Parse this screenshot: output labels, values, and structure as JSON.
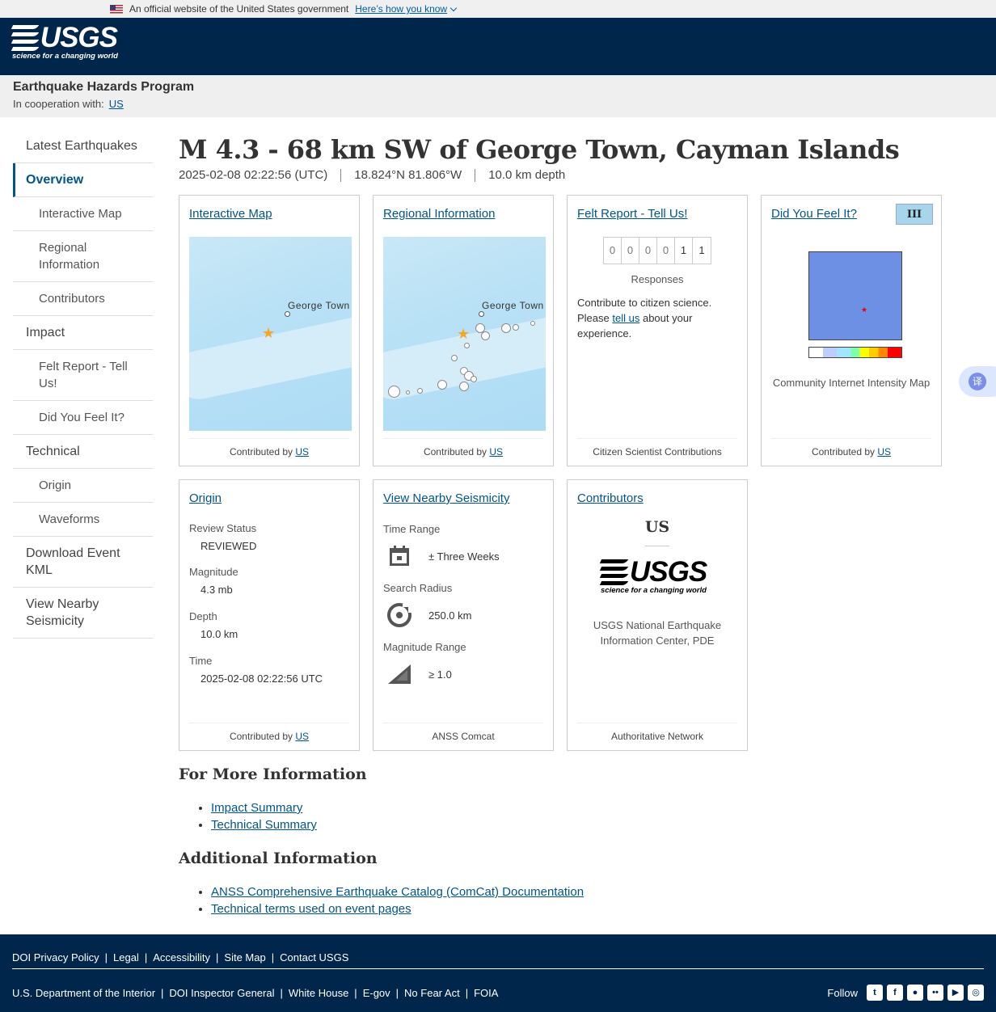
{
  "gov_banner": {
    "text": "An official website of the United States government",
    "link": "Here’s how you know"
  },
  "logo": {
    "word": "USGS",
    "tagline": "science for a changing world"
  },
  "program": {
    "title": "Earthquake Hazards Program",
    "coop_label": "In cooperation with:",
    "coop_link": "US"
  },
  "nav": [
    {
      "label": "Latest Earthquakes"
    },
    {
      "label": "Overview"
    },
    {
      "label": "Interactive Map"
    },
    {
      "label": "Regional Information"
    },
    {
      "label": "Contributors"
    },
    {
      "label": "Impact"
    },
    {
      "label": "Felt Report - Tell Us!"
    },
    {
      "label": "Did You Feel It?"
    },
    {
      "label": "Technical"
    },
    {
      "label": "Origin"
    },
    {
      "label": "Waveforms"
    },
    {
      "label": "Download Event KML"
    },
    {
      "label": "View Nearby Seismicity"
    }
  ],
  "event": {
    "title": "M 4.3 - 68 km SW of George Town, Cayman Islands",
    "time": "2025-02-08 02:22:56 (UTC)",
    "location": "18.824°N 81.806°W",
    "depth": "10.0 km depth"
  },
  "cards": {
    "interactive_map": {
      "title": "Interactive Map",
      "map_label": "George Town",
      "foot_text": "Contributed by",
      "foot_link": "US"
    },
    "regional": {
      "title": "Regional Information",
      "map_label": "George Town",
      "foot_text": "Contributed by",
      "foot_link": "US"
    },
    "felt": {
      "title": "Felt Report - Tell Us!",
      "digits": [
        "0",
        "0",
        "0",
        "0",
        "1",
        "1"
      ],
      "responses": "Responses",
      "text_before": "Contribute to citizen science. Please",
      "link": "tell us",
      "text_after": "about your experience.",
      "foot": "Citizen Scientist Contributions"
    },
    "dyfi": {
      "title": "Did You Feel It?",
      "mmi": "III",
      "caption": "Community Internet Intensity Map",
      "foot_text": "Contributed by",
      "foot_link": "US"
    },
    "origin": {
      "title": "Origin",
      "rows": [
        {
          "label": "Review Status",
          "value": "REVIEWED"
        },
        {
          "label": "Magnitude",
          "value": "4.3 mb"
        },
        {
          "label": "Depth",
          "value": "10.0 km"
        },
        {
          "label": "Time",
          "value": "2025-02-08 02:22:56 UTC"
        }
      ],
      "foot_text": "Contributed by",
      "foot_link": "US"
    },
    "seismicity": {
      "title": "View Nearby Seismicity",
      "time_label": "Time Range",
      "time_value": "± Three Weeks",
      "radius_label": "Search Radius",
      "radius_value": "250.0 km",
      "mag_label": "Magnitude Range",
      "mag_value": "≥ 1.0",
      "foot": "ANSS Comcat"
    },
    "contributors": {
      "title": "Contributors",
      "name": "US",
      "desc": "USGS National Earthquake Information Center, PDE",
      "foot": "Authoritative Network"
    }
  },
  "more_info": {
    "heading": "For More Information",
    "links": [
      "Impact Summary",
      "Technical Summary"
    ]
  },
  "additional": {
    "heading": "Additional Information",
    "links": [
      "ANSS Comprehensive Earthquake Catalog (ComCat) Documentation",
      "Technical terms used on event pages"
    ]
  },
  "translate": {
    "glyph": "译"
  },
  "footer": {
    "top_links": [
      "DOI Privacy Policy",
      "Legal",
      "Accessibility",
      "Site Map",
      "Contact USGS"
    ],
    "bottom_links": [
      "U.S. Department of the Interior",
      "DOI Inspector General",
      "White House",
      "E-gov",
      "No Fear Act",
      "FOIA"
    ],
    "follow": "Follow",
    "social": [
      "twitter-icon",
      "facebook-icon",
      "github-icon",
      "flickr-icon",
      "youtube-icon",
      "instagram-icon"
    ]
  }
}
